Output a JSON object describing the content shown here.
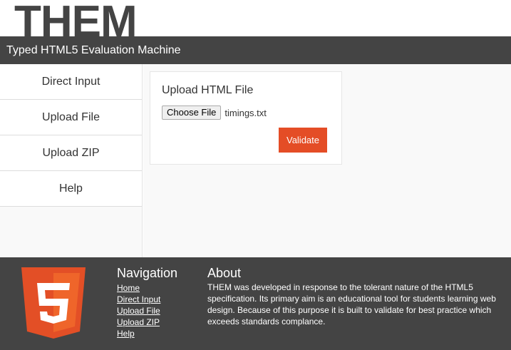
{
  "brand": {
    "logo": "THEM",
    "subtitle": "Typed HTML5 Evaluation Machine"
  },
  "sidebar": {
    "items": [
      {
        "label": "Direct Input"
      },
      {
        "label": "Upload File"
      },
      {
        "label": "Upload ZIP"
      },
      {
        "label": "Help"
      }
    ]
  },
  "upload": {
    "title": "Upload HTML File",
    "choose_label": "Choose File",
    "file_name": "timings.txt",
    "validate_label": "Validate"
  },
  "footer": {
    "nav_heading": "Navigation",
    "nav_links": [
      {
        "label": "Home"
      },
      {
        "label": "Direct Input"
      },
      {
        "label": "Upload File"
      },
      {
        "label": "Upload ZIP"
      },
      {
        "label": "Help"
      }
    ],
    "about_heading": "About",
    "about_text": "THEM was developed in response to the tolerant nature of the HTML5 specification. Its primary aim is an educational tool for students learning web design. Because of this purpose it is built to validate for best practice which exceeds standards complance.",
    "logo_icon": "html5-shield-icon"
  },
  "colors": {
    "accent": "#e44d26",
    "dark": "#444444",
    "panel": "#f9f9f9"
  }
}
